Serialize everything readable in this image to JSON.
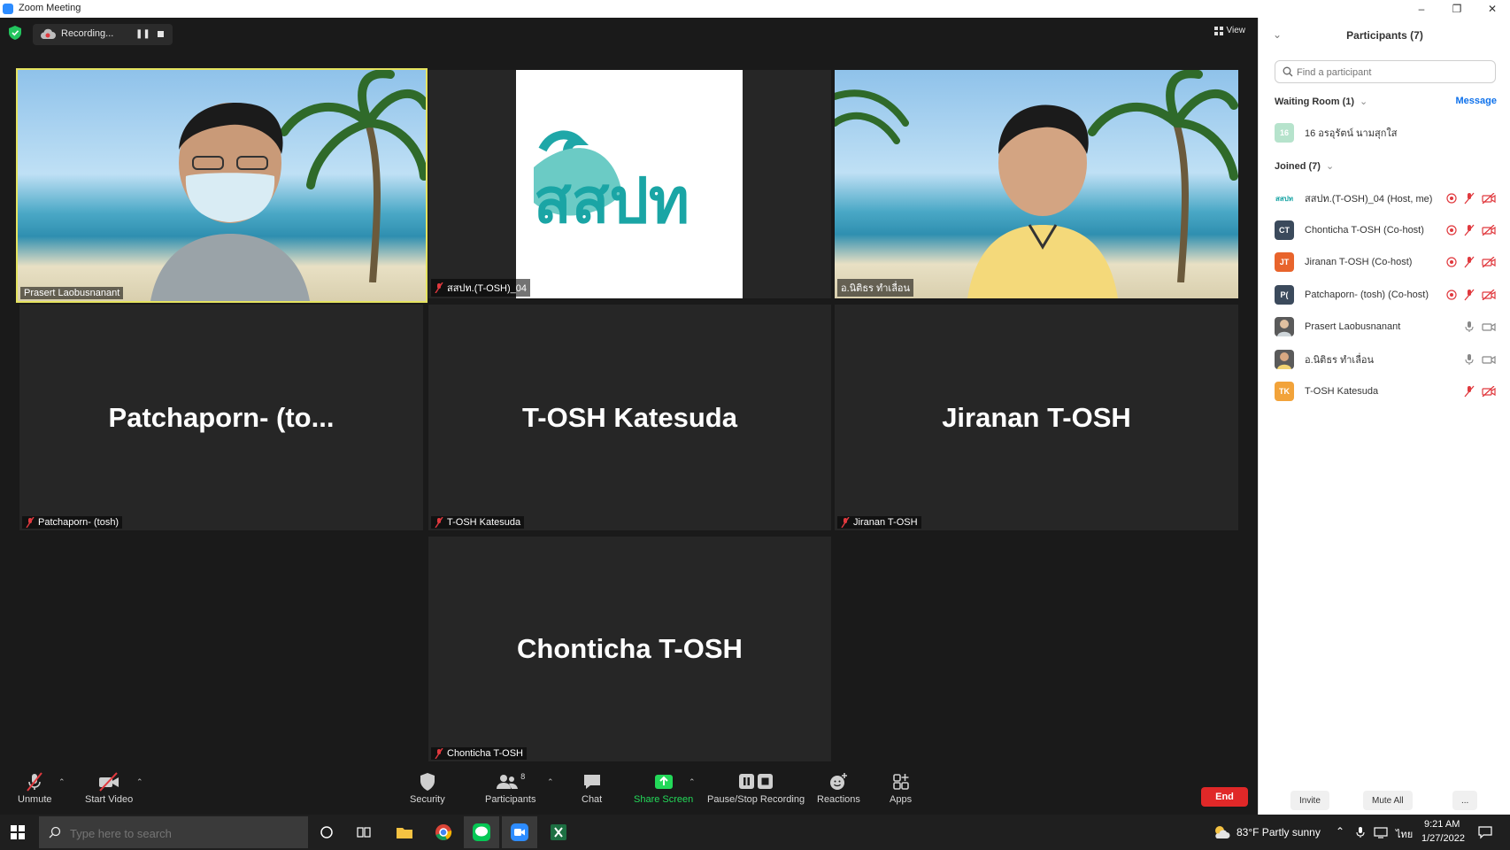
{
  "window": {
    "title": "Zoom Meeting"
  },
  "top": {
    "recording_label": "Recording...",
    "view_label": "View"
  },
  "tiles": {
    "t1": {
      "label": "Prasert Laobusnanant"
    },
    "t2": {
      "label": "สสปท.(T-OSH)_04",
      "logo_text": "สสปท"
    },
    "t3": {
      "label": "อ.นิติธร ทำเลื่อน"
    },
    "t4": {
      "big": "Patchaporn-  (to...",
      "label": "Patchaporn- (tosh)"
    },
    "t5": {
      "big": "T-OSH Katesuda",
      "label": "T-OSH Katesuda"
    },
    "t6": {
      "big": "Jiranan T-OSH",
      "label": "Jiranan T-OSH"
    },
    "t7": {
      "big": "Chonticha T-OSH",
      "label": "Chonticha T-OSH"
    }
  },
  "toolbar": {
    "unmute": "Unmute",
    "start_video": "Start Video",
    "security": "Security",
    "participants": "Participants",
    "participants_count": "8",
    "chat": "Chat",
    "share_screen": "Share Screen",
    "pause_stop_recording": "Pause/Stop Recording",
    "reactions": "Reactions",
    "apps": "Apps",
    "end": "End"
  },
  "panel": {
    "title": "Participants (7)",
    "search_placeholder": "Find a participant",
    "waiting_label": "Waiting Room (1)",
    "message_label": "Message",
    "waiting": [
      {
        "initials": "16",
        "name": "16 อรอุรัตน์ นามสุกใส"
      }
    ],
    "joined_label": "Joined (7)",
    "joined": [
      {
        "initials": "สสปท",
        "name": "สสปท.(T-OSH)_04 (Host, me)",
        "color": "#ffffff"
      },
      {
        "initials": "CT",
        "name": "Chonticha T-OSH (Co-host)",
        "color": "#3b4a5c"
      },
      {
        "initials": "JT",
        "name": "Jiranan T-OSH (Co-host)",
        "color": "#e8642c"
      },
      {
        "initials": "P(",
        "name": "Patchaporn- (tosh) (Co-host)",
        "color": "#3b4a5c"
      },
      {
        "initials": "",
        "name": "Prasert Laobusnanant",
        "color": "#555555"
      },
      {
        "initials": "",
        "name": "อ.นิติธร ทำเลื่อน",
        "color": "#555555"
      },
      {
        "initials": "TK",
        "name": "T-OSH Katesuda",
        "color": "#f2a33a"
      }
    ],
    "invite": "Invite",
    "mute_all": "Mute All",
    "more": "..."
  },
  "taskbar": {
    "search_placeholder": "Type here to search",
    "weather": "83°F  Partly sunny",
    "lang": "ไทย",
    "time": "9:21 AM",
    "date": "1/27/2022"
  },
  "colors": {
    "accent": "#0e71eb",
    "end": "#e02828",
    "share": "#23d959",
    "mic_off": "#e0393e",
    "active_speaker": "#e5e35f"
  }
}
